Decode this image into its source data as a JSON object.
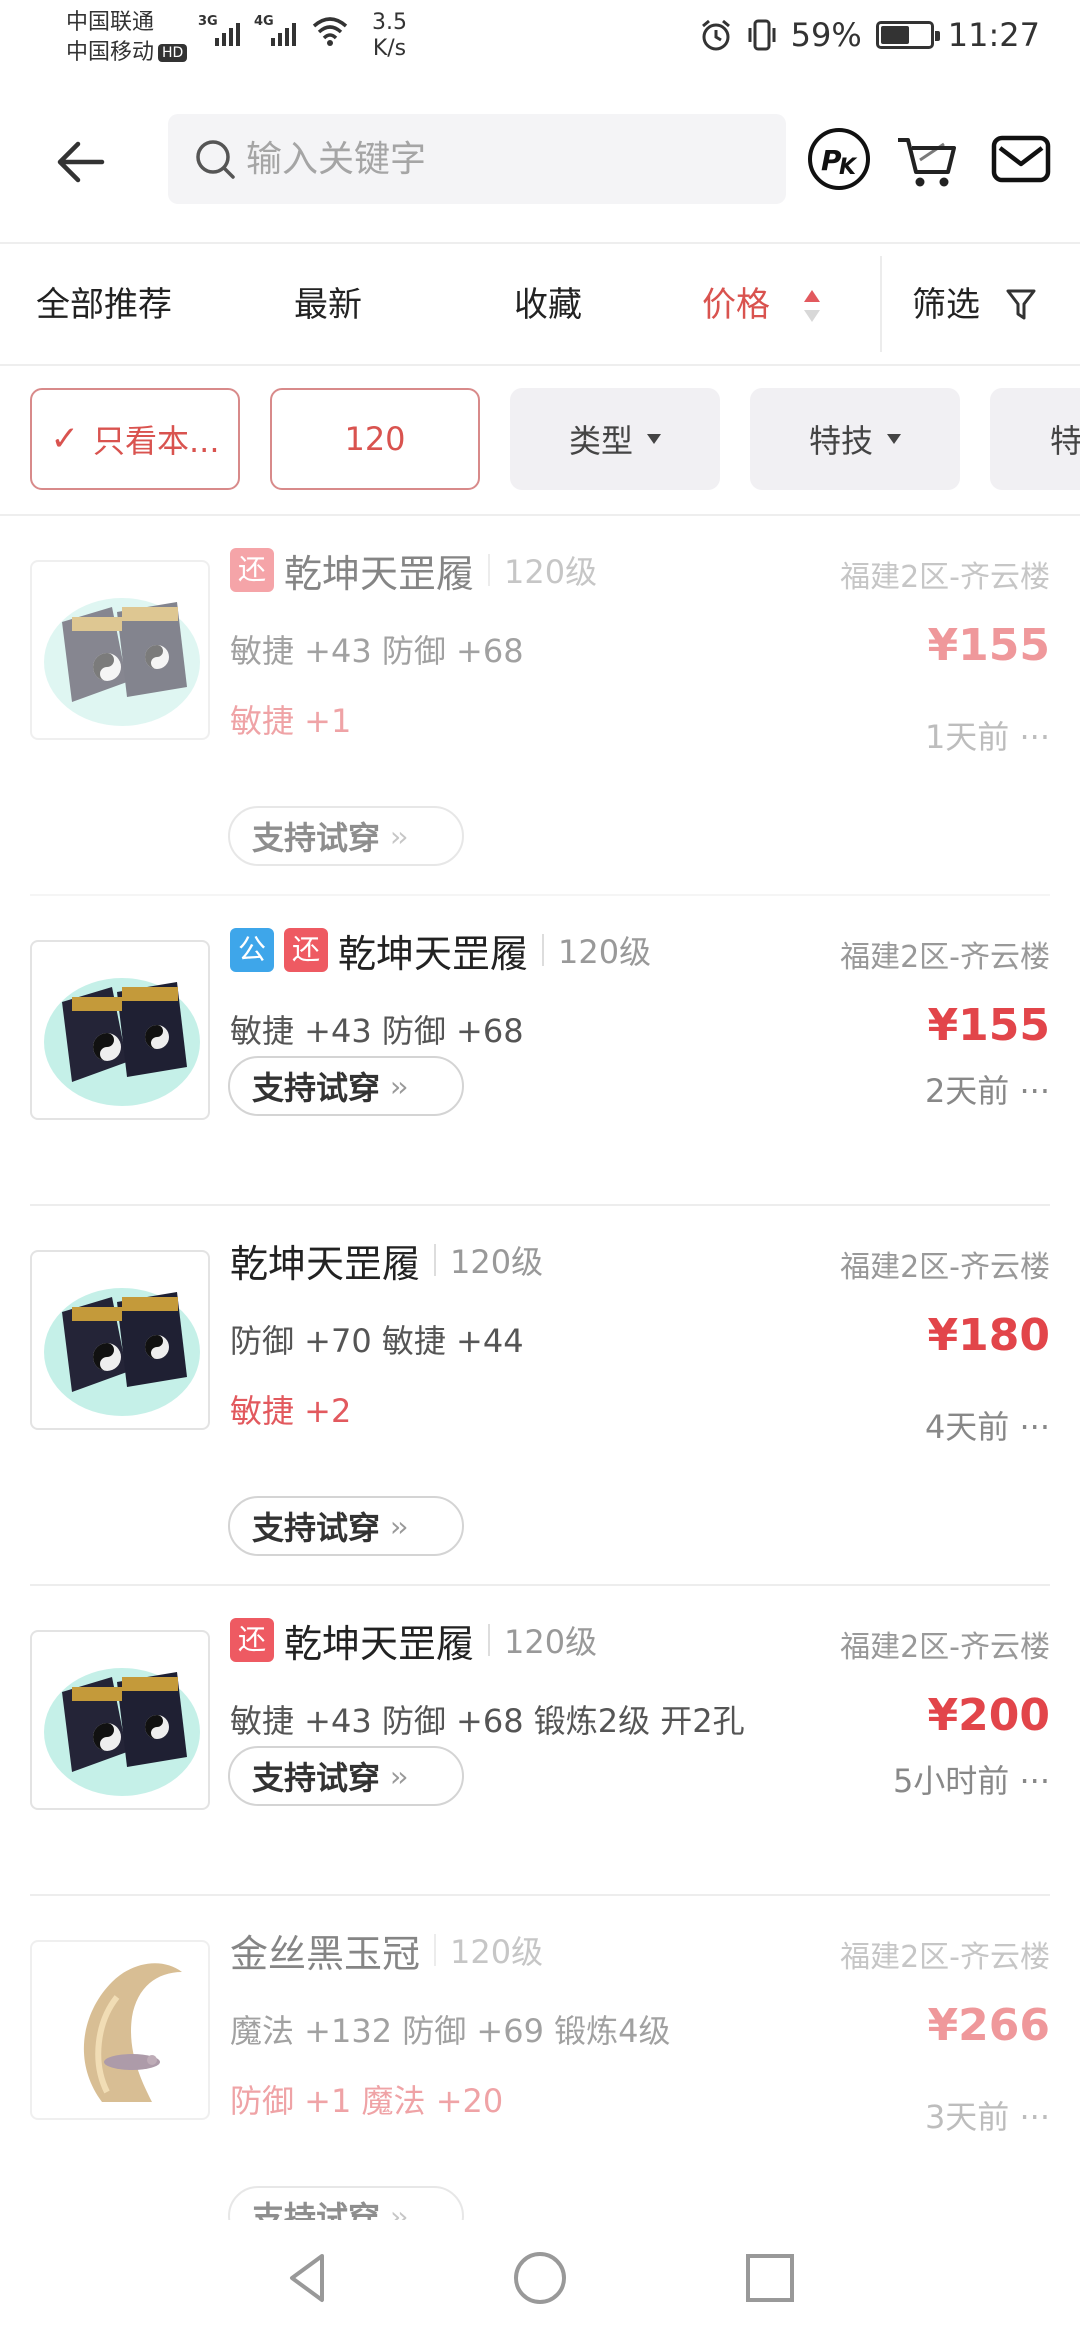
{
  "status_bar": {
    "carrier1": "中国联通",
    "carrier2": "中国移动",
    "hd": "HD",
    "net1": "3G",
    "net2": "4G",
    "speed_value": "3.5",
    "speed_unit": "K/s",
    "battery": "59%",
    "battery_level": 0.59,
    "time": "11:27"
  },
  "header": {
    "search_placeholder": "输入关键字",
    "icons": [
      "back-arrow-icon",
      "search-icon",
      "pk-icon",
      "cart-icon",
      "mail-icon"
    ]
  },
  "sort_tabs": [
    {
      "label": "全部推荐",
      "active": false
    },
    {
      "label": "最新",
      "active": false
    },
    {
      "label": "收藏",
      "active": false
    },
    {
      "label": "价格",
      "active": true
    },
    {
      "label": "筛选",
      "active": false
    }
  ],
  "chips": [
    {
      "label": "只看本...",
      "style": "outline",
      "checked": true
    },
    {
      "label": "120",
      "style": "outline"
    },
    {
      "label": "类型",
      "style": "gray",
      "caret": true
    },
    {
      "label": "特技",
      "style": "gray",
      "caret": true
    },
    {
      "label": "特",
      "style": "gray"
    }
  ],
  "colors": {
    "accent": "#d9534f",
    "price": "#e2454a",
    "badge_huan": "#ee5a62",
    "badge_gong": "#3ea6ea"
  },
  "items": [
    {
      "badges": [
        "还"
      ],
      "name": "乾坤天罡履",
      "level": "120级",
      "server": "福建2区-齐云楼",
      "stats": "敏捷 +43 防御 +68",
      "bonus": "敏捷 +1",
      "price": "¥155",
      "time": "1天前 ···",
      "tryon": "支持试穿",
      "thumb": "boots"
    },
    {
      "badges": [
        "公",
        "还"
      ],
      "name": "乾坤天罡履",
      "level": "120级",
      "server": "福建2区-齐云楼",
      "stats": "敏捷 +43 防御 +68",
      "bonus": "",
      "price": "¥155",
      "time": "2天前 ···",
      "tryon": "支持试穿",
      "thumb": "boots"
    },
    {
      "badges": [],
      "name": "乾坤天罡履",
      "level": "120级",
      "server": "福建2区-齐云楼",
      "stats": "防御 +70 敏捷 +44",
      "bonus": "敏捷 +2",
      "price": "¥180",
      "time": "4天前 ···",
      "tryon": "支持试穿",
      "thumb": "boots"
    },
    {
      "badges": [
        "还"
      ],
      "name": "乾坤天罡履",
      "level": "120级",
      "server": "福建2区-齐云楼",
      "stats": "敏捷 +43 防御 +68 锻炼2级 开2孔",
      "bonus": "",
      "price": "¥200",
      "time": "5小时前 ···",
      "tryon": "支持试穿",
      "thumb": "boots"
    },
    {
      "badges": [],
      "name": "金丝黑玉冠",
      "level": "120级",
      "server": "福建2区-齐云楼",
      "stats": "魔法 +132 防御 +69 锻炼4级",
      "bonus": "防御 +1 魔法 +20",
      "price": "¥266",
      "time": "3天前 ···",
      "tryon": "支持试穿",
      "thumb": "crown"
    }
  ],
  "nav": {
    "icons": [
      "back-triangle-icon",
      "home-circle-icon",
      "recents-square-icon"
    ]
  }
}
